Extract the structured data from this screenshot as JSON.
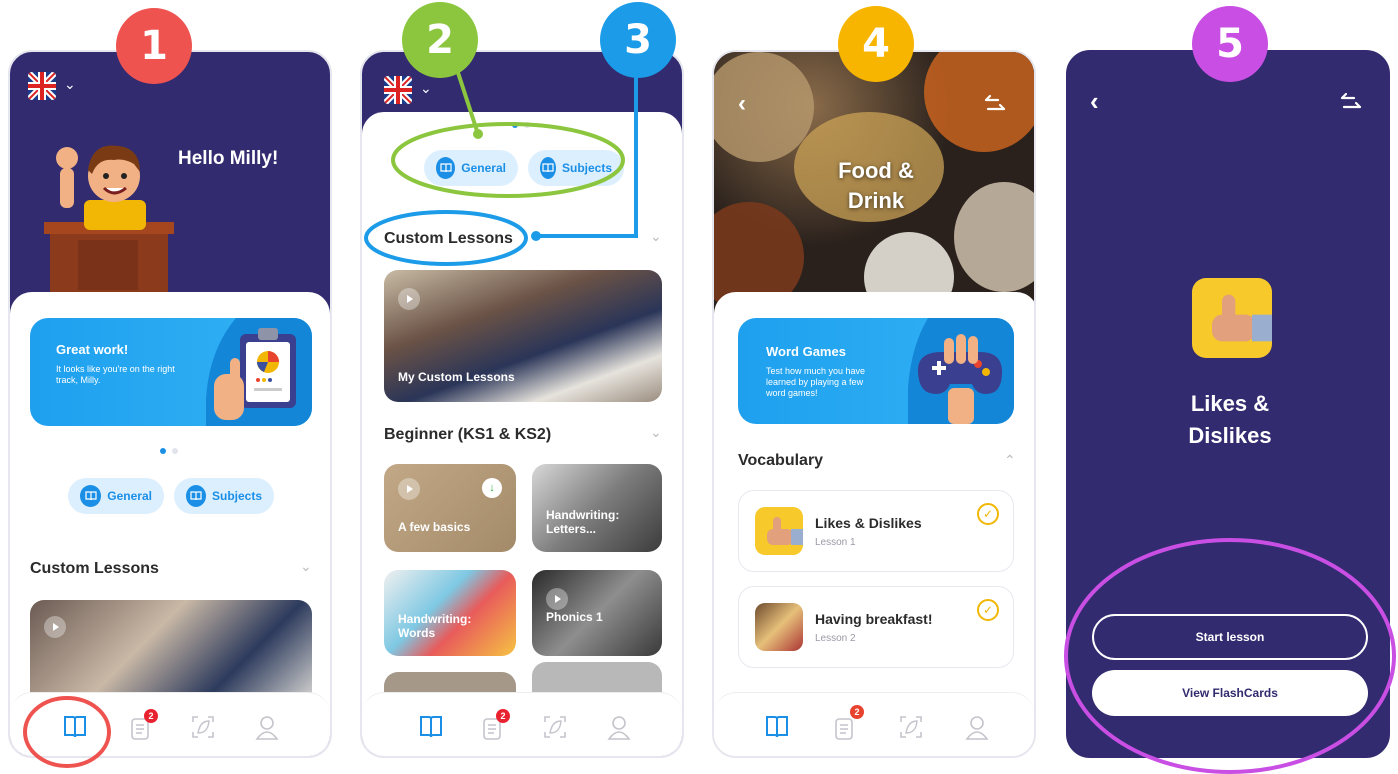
{
  "steps": [
    "1",
    "2",
    "3",
    "4",
    "5"
  ],
  "colors": {
    "navy": "#322b6f",
    "blue": "#1b8fe6",
    "green": "#8cc63f",
    "yellow": "#f7b500",
    "red": "#ef5350",
    "purple": "#c94fe4"
  },
  "screen1": {
    "greeting": "Hello Milly!",
    "promo_title": "Great work!",
    "promo_text": "It looks like you're on the right track, Milly.",
    "pill_general": "General",
    "pill_subjects": "Subjects",
    "section_custom": "Custom Lessons",
    "tab_badge": "2"
  },
  "screen2": {
    "pill_general": "General",
    "pill_subjects": "Subjects",
    "section_custom": "Custom Lessons",
    "card_custom": "My Custom Lessons",
    "section_beginner": "Beginner (KS1 & KS2)",
    "tiles": [
      "A few basics",
      "Handwriting: Letters...",
      "Handwriting: Words",
      "Phonics 1"
    ],
    "tab_badge": "2"
  },
  "screen3": {
    "title_line1": "Food &",
    "title_line2": "Drink",
    "promo_title": "Word Games",
    "promo_text": "Test how much you have learned by playing a few word games!",
    "section_vocab": "Vocabulary",
    "lessons": [
      {
        "title": "Likes & Dislikes",
        "sub": "Lesson 1"
      },
      {
        "title": "Having breakfast!",
        "sub": "Lesson 2"
      }
    ],
    "tab_badge": "2"
  },
  "screen4": {
    "title_line1": "Likes &",
    "title_line2": "Dislikes",
    "start_button": "Start lesson",
    "flashcards_button": "View FlashCards"
  }
}
